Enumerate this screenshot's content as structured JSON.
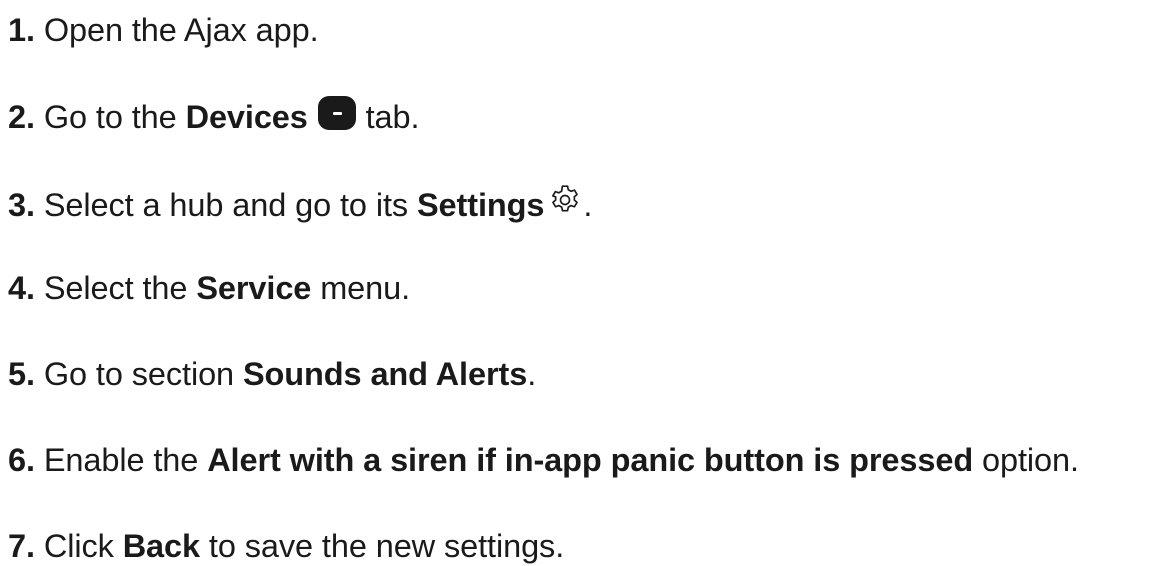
{
  "steps": [
    {
      "num": "1.",
      "parts": [
        " Open the Ajax app."
      ]
    },
    {
      "num": "2.",
      "pre": " Go to the ",
      "bold": "Devices",
      "post": " tab."
    },
    {
      "num": "3.",
      "pre": " Select a hub and go to its ",
      "bold": "Settings",
      "post": "."
    },
    {
      "num": "4.",
      "pre": " Select the ",
      "bold": "Service",
      "post": " menu."
    },
    {
      "num": "5.",
      "pre": " Go to section ",
      "bold": "Sounds and Alerts",
      "post": "."
    },
    {
      "num": "6.",
      "pre": " Enable the ",
      "bold": "Alert with a siren if in-app panic button is pressed",
      "post": " option."
    },
    {
      "num": "7.",
      "pre": " Click ",
      "bold": "Back",
      "post": " to save the new settings."
    }
  ],
  "icons": {
    "devices": "devices-tab-icon",
    "settings": "gear-icon"
  }
}
